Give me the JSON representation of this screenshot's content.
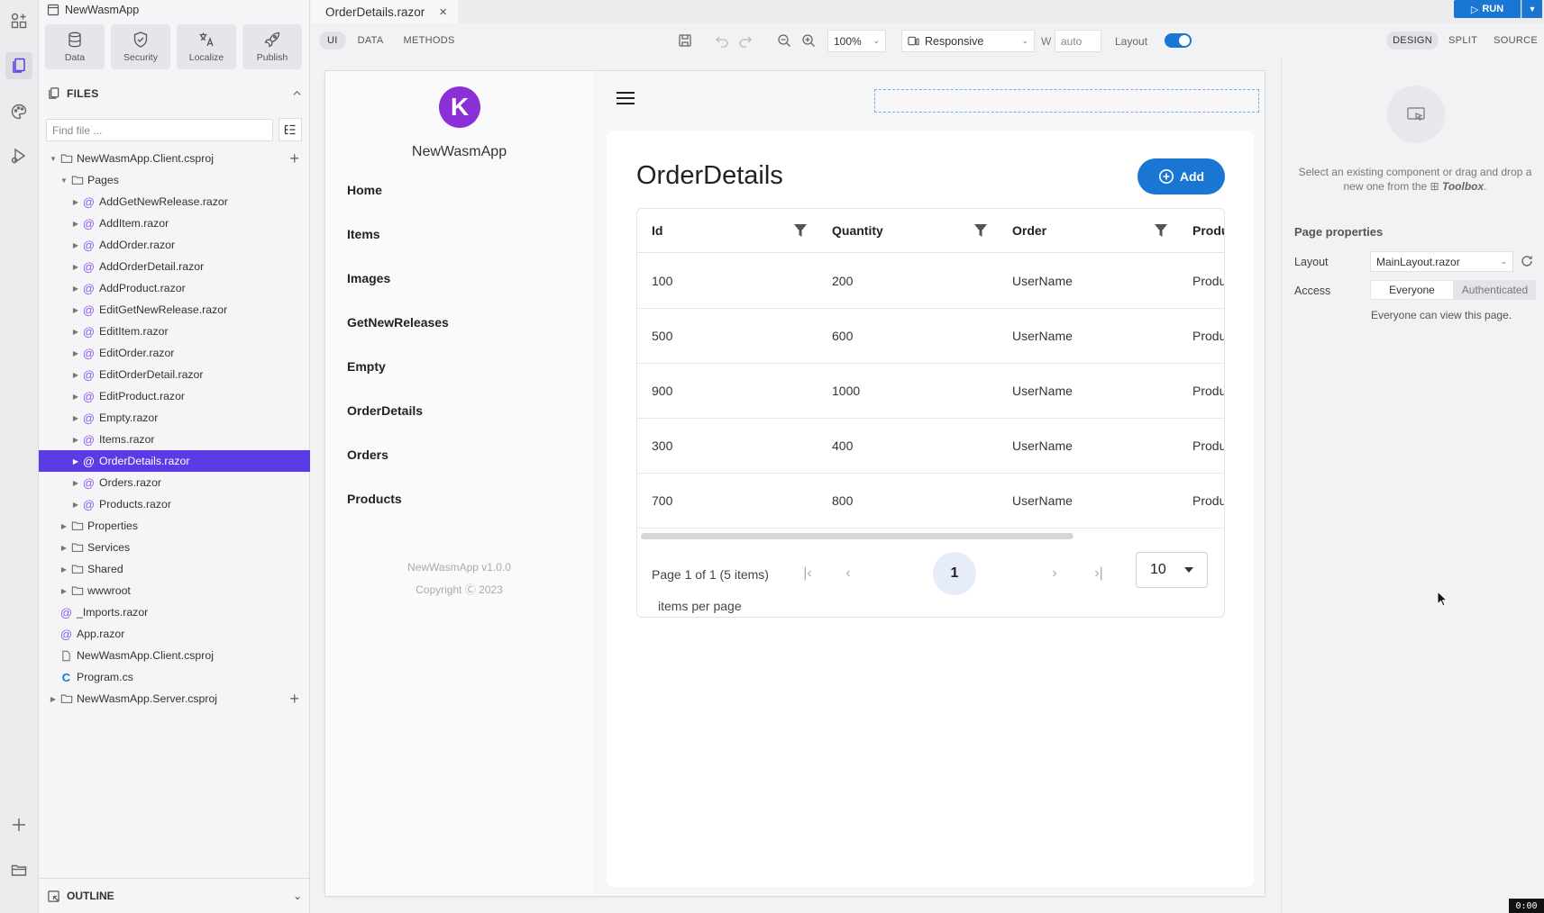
{
  "app": {
    "title": "NewWasmApp",
    "tools": [
      {
        "label": "Data",
        "icon": "database-icon"
      },
      {
        "label": "Security",
        "icon": "shield-icon"
      },
      {
        "label": "Localize",
        "icon": "translate-icon"
      },
      {
        "label": "Publish",
        "icon": "rocket-icon"
      }
    ]
  },
  "files": {
    "header": "FILES",
    "find_placeholder": "Find file ...",
    "tree": [
      {
        "label": "NewWasmApp.Client.csproj",
        "level": 1,
        "type": "folder",
        "expanded": true,
        "plus": true
      },
      {
        "label": "Pages",
        "level": 2,
        "type": "folder",
        "expanded": true
      },
      {
        "label": "AddGetNewRelease.razor",
        "level": 3,
        "type": "razor"
      },
      {
        "label": "AddItem.razor",
        "level": 3,
        "type": "razor"
      },
      {
        "label": "AddOrder.razor",
        "level": 3,
        "type": "razor"
      },
      {
        "label": "AddOrderDetail.razor",
        "level": 3,
        "type": "razor"
      },
      {
        "label": "AddProduct.razor",
        "level": 3,
        "type": "razor"
      },
      {
        "label": "EditGetNewRelease.razor",
        "level": 3,
        "type": "razor"
      },
      {
        "label": "EditItem.razor",
        "level": 3,
        "type": "razor"
      },
      {
        "label": "EditOrder.razor",
        "level": 3,
        "type": "razor"
      },
      {
        "label": "EditOrderDetail.razor",
        "level": 3,
        "type": "razor"
      },
      {
        "label": "EditProduct.razor",
        "level": 3,
        "type": "razor"
      },
      {
        "label": "Empty.razor",
        "level": 3,
        "type": "razor"
      },
      {
        "label": "Items.razor",
        "level": 3,
        "type": "razor"
      },
      {
        "label": "OrderDetails.razor",
        "level": 3,
        "type": "razor",
        "selected": true
      },
      {
        "label": "Orders.razor",
        "level": 3,
        "type": "razor"
      },
      {
        "label": "Products.razor",
        "level": 3,
        "type": "razor"
      },
      {
        "label": "Properties",
        "level": 2,
        "type": "folder"
      },
      {
        "label": "Services",
        "level": 2,
        "type": "folder"
      },
      {
        "label": "Shared",
        "level": 2,
        "type": "folder"
      },
      {
        "label": "wwwroot",
        "level": 2,
        "type": "folder"
      },
      {
        "label": "_Imports.razor",
        "level": 2,
        "type": "razor-leaf"
      },
      {
        "label": "App.razor",
        "level": 2,
        "type": "razor-leaf"
      },
      {
        "label": "NewWasmApp.Client.csproj",
        "level": 2,
        "type": "file"
      },
      {
        "label": "Program.cs",
        "level": 2,
        "type": "cs"
      },
      {
        "label": "NewWasmApp.Server.csproj",
        "level": 1,
        "type": "folder",
        "plus": true
      }
    ],
    "outline_header": "OUTLINE"
  },
  "editor": {
    "tab_label": "OrderDetails.razor",
    "run_label": "RUN",
    "modes": [
      "UI",
      "DATA",
      "METHODS"
    ],
    "zoom": "100%",
    "responsive": "Responsive",
    "width_label": "W",
    "width_placeholder": "auto",
    "layout_label": "Layout",
    "views": [
      "DESIGN",
      "SPLIT",
      "SOURCE"
    ]
  },
  "preview": {
    "app_name": "NewWasmApp",
    "logo_letter": "K",
    "nav": [
      "Home",
      "Items",
      "Images",
      "GetNewReleases",
      "Empty",
      "OrderDetails",
      "Orders",
      "Products"
    ],
    "footer_version": "NewWasmApp v1.0.0",
    "footer_copyright": "Copyright Ⓒ 2023",
    "page_title": "OrderDetails",
    "add_label": "Add",
    "columns": [
      "Id",
      "Quantity",
      "Order",
      "Produ"
    ],
    "rows": [
      [
        "100",
        "200",
        "UserName",
        "Produ"
      ],
      [
        "500",
        "600",
        "UserName",
        "Produ"
      ],
      [
        "900",
        "1000",
        "UserName",
        "Produ"
      ],
      [
        "300",
        "400",
        "UserName",
        "Produ"
      ],
      [
        "700",
        "800",
        "UserName",
        "Produ"
      ]
    ],
    "pager_summary": "Page 1 of 1 (5 items)",
    "current_page": "1",
    "page_size": "10",
    "items_per_page": "items per page"
  },
  "properties": {
    "hint_pre": "Select an existing component or drag and drop a new one from the",
    "hint_toolbox": "Toolbox",
    "hint_post": ".",
    "section": "Page properties",
    "layout_label": "Layout",
    "layout_value": "MainLayout.razor",
    "access_label": "Access",
    "access_options": [
      "Everyone",
      "Authenticated"
    ],
    "access_note": "Everyone can view this page."
  },
  "clock": "0:00"
}
